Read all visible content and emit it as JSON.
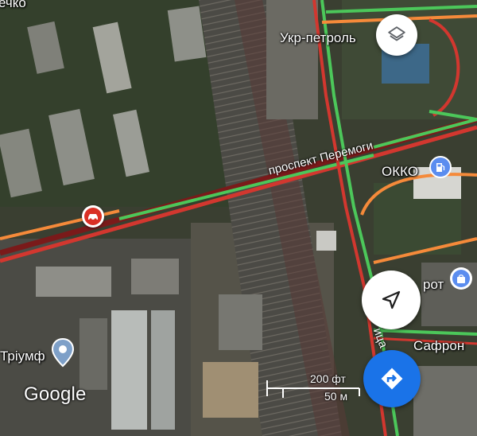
{
  "map": {
    "labels": {
      "top_left_fragment": "ечко",
      "ukr_petrol": "Укр-петроль",
      "street_main": "проспект Перемоги",
      "okko": "ОККО",
      "rot_fragment": "рот",
      "triumf": "Тріумф",
      "safron": "Сафрон",
      "street_vertical": "ица ка-К"
    },
    "brand": "Google",
    "scale": {
      "imperial": "200 фт",
      "metric": "50 м"
    },
    "colors": {
      "traffic_green": "#4cc75a",
      "traffic_orange": "#f58a3a",
      "traffic_red": "#d2372f",
      "traffic_darkred": "#7a1a1a",
      "directions_blue": "#1a73e8",
      "accident_red": "#d93025",
      "poi_blue": "#5b8def"
    }
  },
  "controls": {
    "layers_icon": "layers-icon",
    "location_icon": "navigation-arrow-icon",
    "directions_icon": "directions-icon",
    "accident_icon": "car-crash-icon",
    "gas_icon": "gas-station-icon",
    "shopping_icon": "shopping-bag-icon",
    "place_pin_icon": "place-pin-icon"
  }
}
